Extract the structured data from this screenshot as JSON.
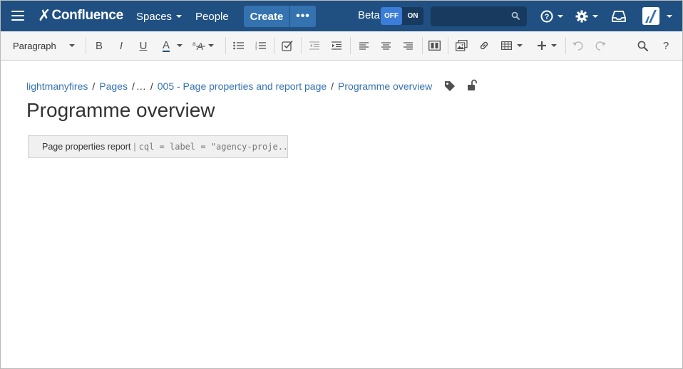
{
  "nav": {
    "logo_mark": "✗",
    "logo_text": "Confluence",
    "spaces_label": "Spaces",
    "people_label": "People",
    "create_label": "Create",
    "more_label": "•••",
    "beta_label": "Beta",
    "toggle_off": "OFF",
    "toggle_on": "ON",
    "search_placeholder": "",
    "icons": [
      "menu-icon",
      "search-icon",
      "help-icon",
      "gear-icon",
      "notifications-icon",
      "avatar"
    ]
  },
  "toolbar": {
    "paragraph_label": "Paragraph",
    "bold": "B",
    "italic": "I",
    "underline": "U",
    "text_color": "A",
    "text_color_value": "#205081",
    "help": "?"
  },
  "breadcrumb": {
    "items": [
      "lightmanyfires",
      "Pages",
      "…",
      "005 - Page properties and report page",
      "Programme overview"
    ],
    "separator": "/"
  },
  "page": {
    "title": "Programme overview"
  },
  "macro": {
    "title": "Page properties report",
    "separator": "|",
    "params": "cql = label = \"agency-proje..."
  },
  "colors": {
    "nav_bg": "#205081",
    "button_bg": "#3572b0",
    "link": "#3572b0",
    "toggle_off_bg": "#3b7dd8"
  }
}
